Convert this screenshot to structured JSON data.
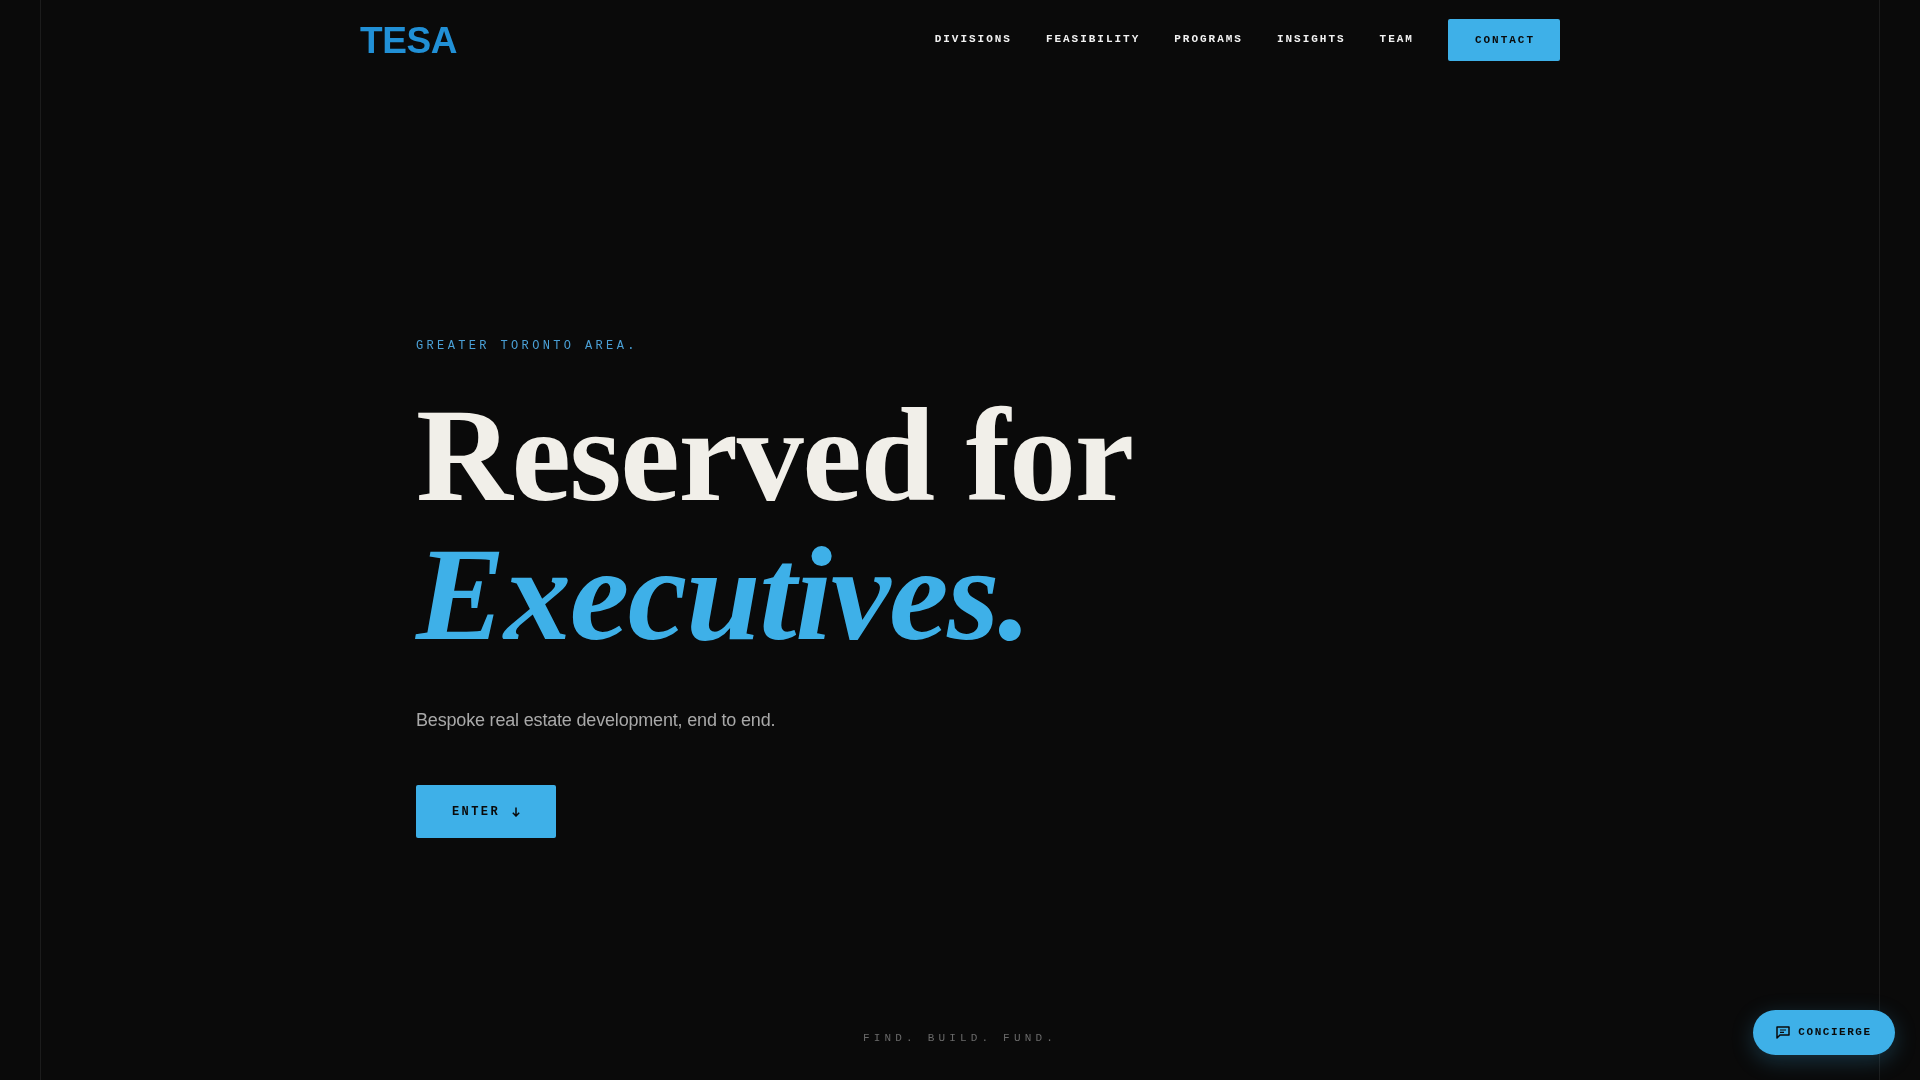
{
  "navbar": {
    "logo": "TESA",
    "links": [
      {
        "label": "DIVISIONS"
      },
      {
        "label": "FEASIBILITY"
      },
      {
        "label": "PROGRAMS"
      },
      {
        "label": "INSIGHTS"
      },
      {
        "label": "TEAM"
      }
    ],
    "cta_button": "CONTACT"
  },
  "hero": {
    "eyebrow": "GREATER TORONTO AREA.",
    "title_line_1": "Reserved for",
    "title_line_2": "Executives.",
    "subtitle": "Bespoke real estate development, end to end.",
    "button": "ENTER"
  },
  "tagline": "FIND. BUILD. FUND.",
  "concierge_button": "CONCIERGE"
}
